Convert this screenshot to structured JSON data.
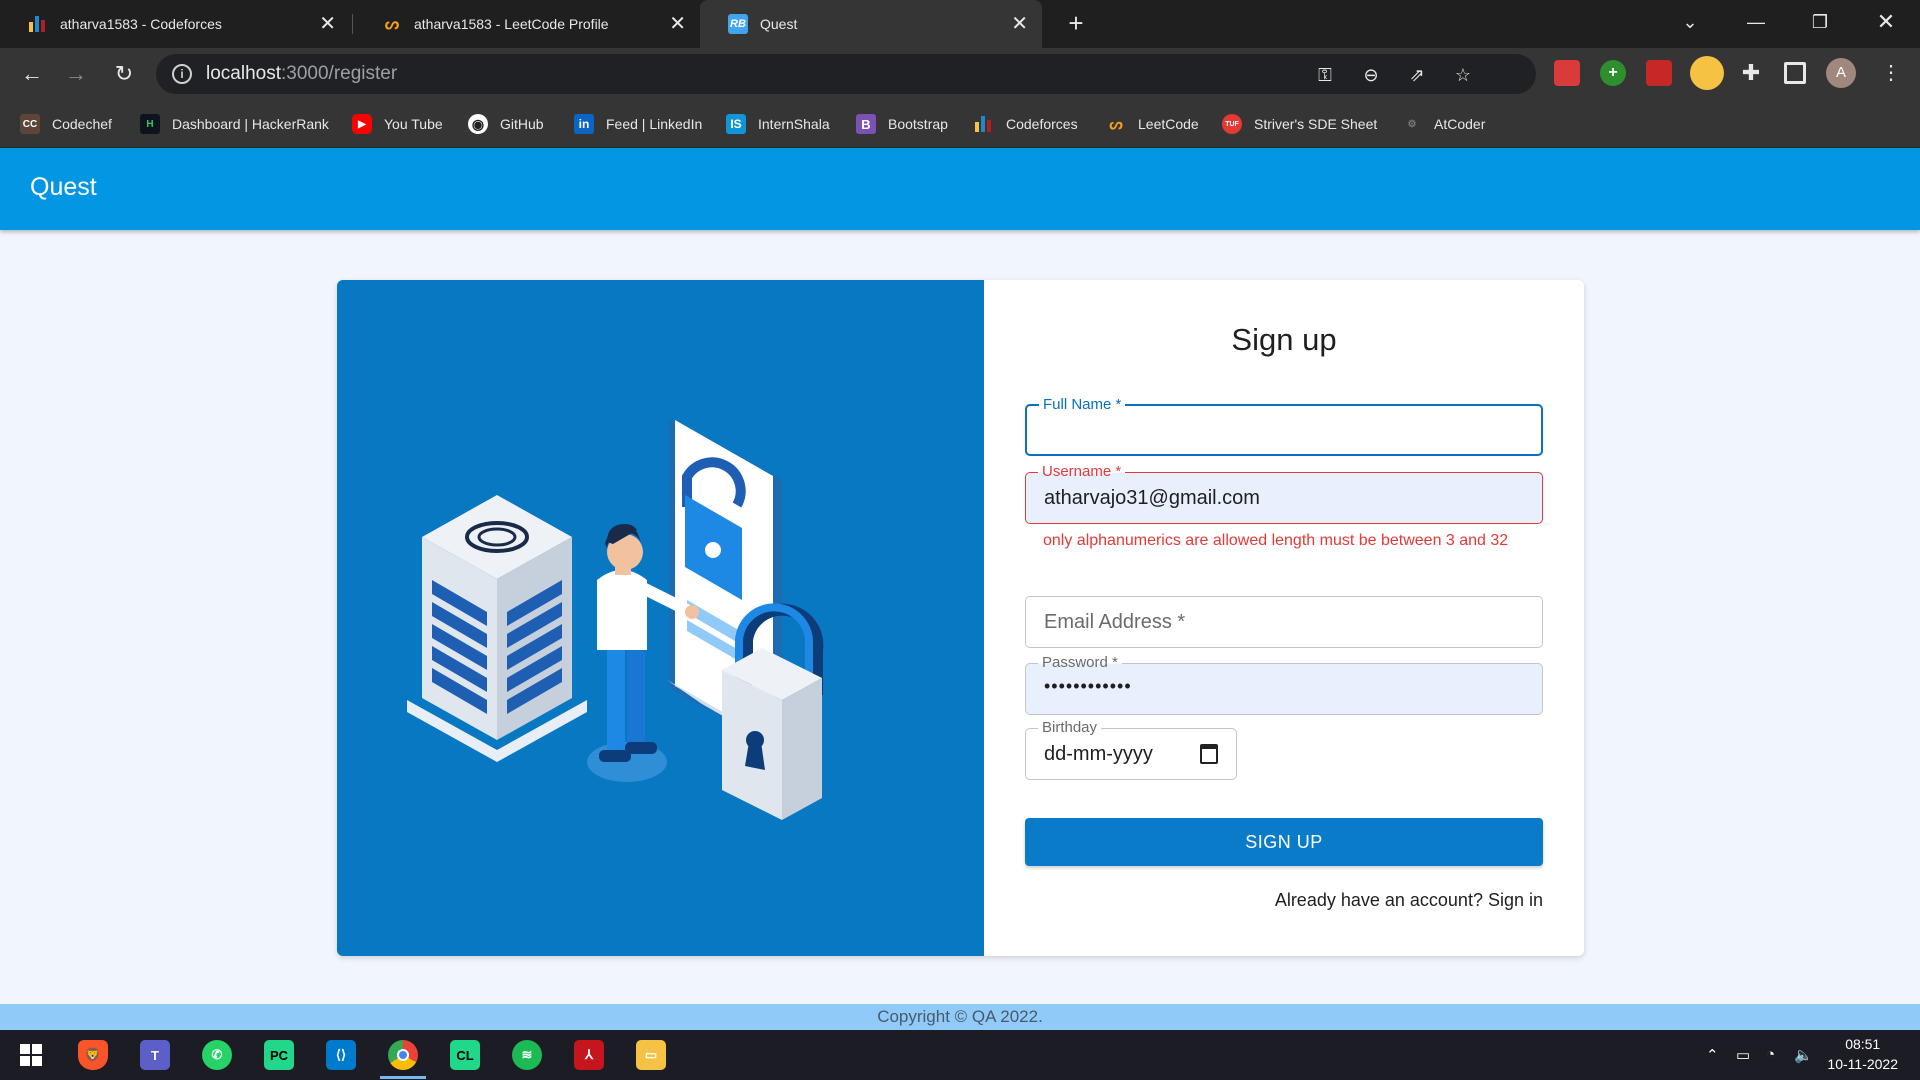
{
  "browser": {
    "tabs": [
      {
        "title": "atharva1583 - Codeforces",
        "icon": "codeforces-icon"
      },
      {
        "title": "atharva1583 - LeetCode Profile",
        "icon": "leetcode-icon"
      },
      {
        "title": "Quest",
        "icon": "react-bootstrap-icon"
      }
    ],
    "url_host": "localhost",
    "url_path": ":3000/register",
    "bookmarks": [
      {
        "label": "Codechef",
        "icon": "codechef-icon",
        "badge": "CC",
        "color": "#5b4638"
      },
      {
        "label": "Dashboard | HackerRank",
        "icon": "hackerrank-icon",
        "badge": "H",
        "color": "#0e141e"
      },
      {
        "label": "You Tube",
        "icon": "youtube-icon",
        "badge": "▶",
        "color": "#ff0000"
      },
      {
        "label": "GitHub",
        "icon": "github-icon",
        "badge": "◉",
        "color": "#333333"
      },
      {
        "label": "Feed | LinkedIn",
        "icon": "linkedin-icon",
        "badge": "in",
        "color": "#0a66c2"
      },
      {
        "label": "InternShala",
        "icon": "internshala-icon",
        "badge": "IS",
        "color": "#1295d8"
      },
      {
        "label": "Bootstrap",
        "icon": "bootstrap-icon",
        "badge": "B",
        "color": "#7952b3"
      },
      {
        "label": "Codeforces",
        "icon": "codeforces-icon",
        "badge": "▮",
        "color": "#1f8acb"
      },
      {
        "label": "LeetCode",
        "icon": "leetcode-icon",
        "badge": "L",
        "color": "#353535"
      },
      {
        "label": "Striver's SDE Sheet",
        "icon": "tuf-icon",
        "badge": "TUF",
        "color": "#e53935"
      },
      {
        "label": "AtCoder",
        "icon": "atcoder-icon",
        "badge": "A",
        "color": "#353535"
      }
    ],
    "profile_initial": "A"
  },
  "app": {
    "title": "Quest",
    "form": {
      "heading": "Sign up",
      "full_name_label": "Full Name *",
      "full_name_value": "",
      "username_label": "Username *",
      "username_value": "atharvajo31@gmail.com",
      "username_error": "only alphanumerics are allowed length must be between 3 and 32",
      "email_placeholder": "Email Address *",
      "password_label": "Password *",
      "password_value": "••••••••••••",
      "birthday_label": "Birthday",
      "birthday_value": "dd-mm-yyyy",
      "submit_label": "SIGN UP",
      "signin_link": "Already have an account? Sign in"
    },
    "footer": "Copyright © QA 2022."
  },
  "taskbar": {
    "apps": [
      "windows-start-icon",
      "brave-icon",
      "teams-icon",
      "whatsapp-icon",
      "pycharm-icon",
      "vscode-icon",
      "chrome-icon",
      "clion-icon",
      "spotify-icon",
      "acrobat-icon",
      "file-explorer-icon"
    ],
    "time": "08:51",
    "date": "10-11-2022"
  },
  "colors": {
    "accent": "#0396e2",
    "hero_bg": "#0778c1",
    "error": "#e53935",
    "button": "#0a7bc9"
  }
}
